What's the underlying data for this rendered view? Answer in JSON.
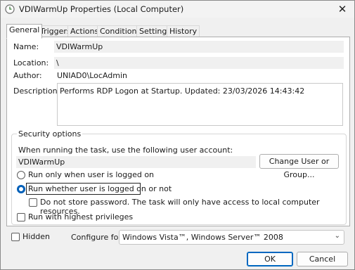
{
  "window": {
    "title": "VDIWarmUp Properties (Local Computer)",
    "icon": "clock-icon",
    "close_glyph": "✕"
  },
  "tabs": [
    {
      "label": "General",
      "active": true
    },
    {
      "label": "Triggers",
      "active": false
    },
    {
      "label": "Actions",
      "active": false
    },
    {
      "label": "Conditions",
      "active": false
    },
    {
      "label": "Settings",
      "active": false
    },
    {
      "label": "History",
      "active": false
    }
  ],
  "general": {
    "name_label": "Name:",
    "name_value": "VDIWarmUp",
    "location_label": "Location:",
    "location_value": "\\",
    "author_label": "Author:",
    "author_value": "UNIAD0\\LocAdmin",
    "description_label": "Description:",
    "description_value": "Performs RDP Logon at Startup. Updated: 23/03/2026 14:43:42"
  },
  "security": {
    "group_title": "Security options",
    "account_prompt": "When running the task, use the following user account:",
    "account_value": "VDIWarmUp",
    "change_user_button": "Change User or Group...",
    "radio_logged_on": "Run only when user is logged on",
    "radio_whether": "Run whether user is logged on or not",
    "selected_radio": "radio_whether",
    "no_store_password": "Do not store password.  The task will only have access to local computer resources.",
    "no_store_password_checked": false,
    "highest_privileges": "Run with highest privileges",
    "highest_privileges_checked": false
  },
  "footer": {
    "hidden_label": "Hidden",
    "hidden_checked": false,
    "configure_for_label": "Configure for:",
    "configure_for_value": "Windows Vista™, Windows Server™ 2008",
    "ok_button": "OK",
    "cancel_button": "Cancel"
  },
  "colors": {
    "accent": "#005fb8",
    "panel_bg": "#ffffff",
    "window_bg": "#f0f0f0"
  }
}
